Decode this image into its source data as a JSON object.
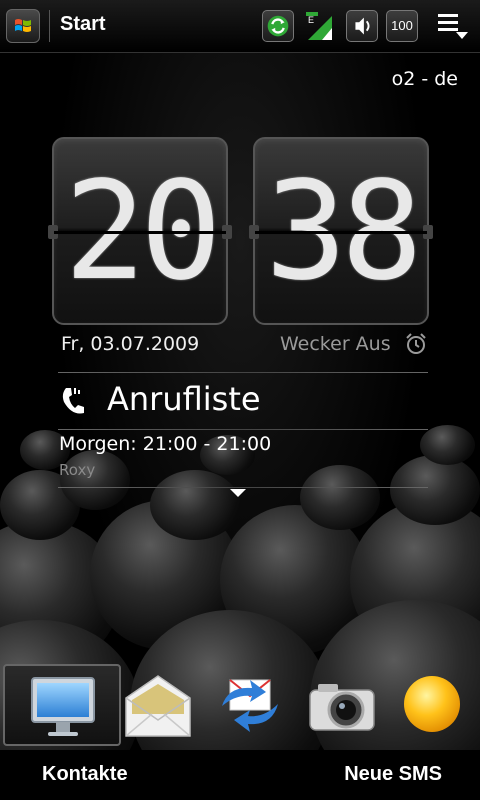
{
  "statusbar": {
    "title": "Start",
    "battery": "100",
    "icons": [
      "windows-start-icon",
      "sync-icon",
      "signal-edge-icon",
      "volume-icon",
      "battery-icon",
      "menu-icon"
    ]
  },
  "operator": "o2 - de",
  "clock": {
    "hours": "20",
    "minutes": "38"
  },
  "date": "Fr, 03.07.2009",
  "alarm": "Wecker Aus",
  "call_list_label": "Anrufliste",
  "event": {
    "title": "Morgen: 21:00 - 21:00",
    "subtitle": "Roxy"
  },
  "dock": {
    "items": [
      "computer-icon",
      "mail-envelope-icon",
      "sync-mail-icon",
      "camera-icon",
      "weather-sun-icon"
    ]
  },
  "softkeys": {
    "left": "Kontakte",
    "right": "Neue SMS"
  }
}
